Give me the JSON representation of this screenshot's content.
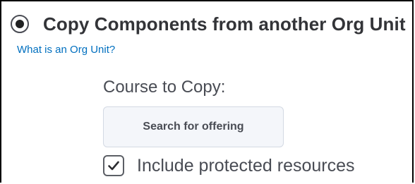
{
  "copy_option": {
    "label": "Copy Components from another Org Unit",
    "selected": true,
    "help_link": "What is an Org Unit?"
  },
  "course_to_copy": {
    "label": "Course to Copy:",
    "search_button": "Search for offering"
  },
  "protected_resources": {
    "label": "Include protected resources",
    "checked": true
  },
  "colors": {
    "link": "#006fbf",
    "text": "#494c54",
    "heading": "#333438",
    "button_bg": "#f4f6fa",
    "button_border": "#d3d9e3"
  },
  "icons": {
    "radio": "radio-selected-icon",
    "checkbox": "checkmark-icon"
  }
}
